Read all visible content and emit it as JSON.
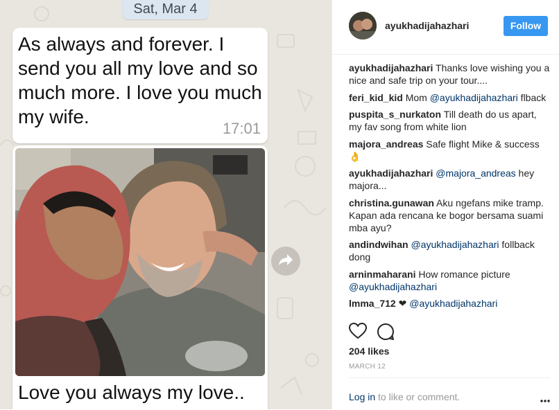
{
  "chat": {
    "date": "Sat, Mar 4",
    "message_text": "As always and forever. I send you all my love and so much more. I love you much my wife.",
    "message_time": "17:01",
    "photo_caption": "Love you always my love..",
    "forward_icon": "forward-arrow-icon"
  },
  "instagram": {
    "username": "ayukhadijahazhari",
    "follow_label": "Follow",
    "comments": [
      {
        "user": "ayukhadijahazhari",
        "mention": "",
        "text": "Thanks love wishing you a nice and safe trip on your tour....",
        "after": ""
      },
      {
        "user": "feri_kid_kid",
        "mention": "",
        "text": "Mom ",
        "mention2": "@ayukhadijahazhari",
        "after": " flback"
      },
      {
        "user": "puspita_s_nurkaton",
        "mention": "",
        "text": "Till death do us apart, my fav song from white lion",
        "after": ""
      },
      {
        "user": "majora_andreas",
        "mention": "",
        "text": "Safe flight Mike & success 👌",
        "after": ""
      },
      {
        "user": "ayukhadijahazhari",
        "mention": "@majora_andreas",
        "text": "",
        "after": " hey majora..."
      },
      {
        "user": "christina.gunawan",
        "mention": "",
        "text": "Aku ngefans mike tramp. Kapan ada rencana ke bogor bersama suami mba ayu?",
        "after": ""
      },
      {
        "user": "andindwihan",
        "mention": "@ayukhadijahazhari",
        "text": "",
        "after": " follback dong"
      },
      {
        "user": "arninmaharani",
        "mention": "",
        "text": "How romance picture ",
        "mention2": "@ayukhadijahazhari",
        "after": ""
      },
      {
        "user": "lmma_712",
        "mention": "",
        "text": "❤ ",
        "mention2": "@ayukhadijahazhari",
        "after": ""
      }
    ],
    "likes": "204 likes",
    "date": "MARCH 12",
    "login_link": "Log in",
    "login_rest": " to like or comment.",
    "icons": {
      "like": "heart-icon",
      "comment": "comment-icon",
      "more": "more-options-icon"
    },
    "colors": {
      "follow": "#3897f0",
      "link": "#003569"
    }
  }
}
